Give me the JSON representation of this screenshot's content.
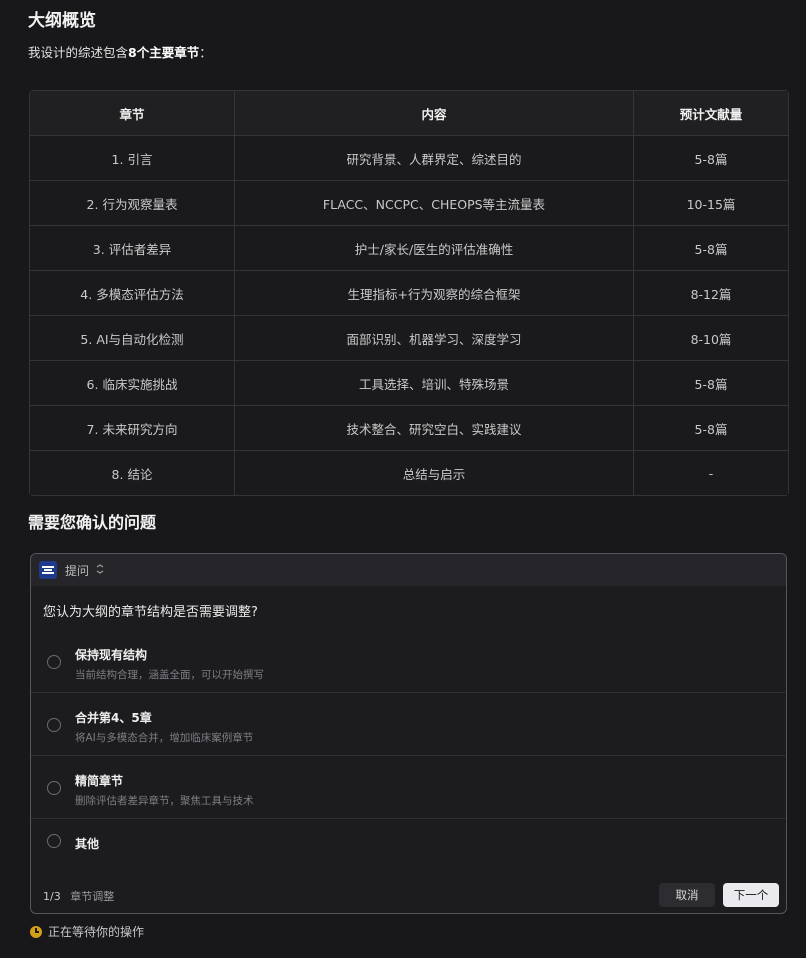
{
  "outline": {
    "heading": "大纲概览",
    "intro_prefix": "我设计的综述包含",
    "intro_bold": "8个主要章节",
    "intro_suffix": "：",
    "columns": [
      "章节",
      "内容",
      "预计文献量"
    ],
    "rows": [
      [
        "1. 引言",
        "研究背景、人群界定、综述目的",
        "5-8篇"
      ],
      [
        "2. 行为观察量表",
        "FLACC、NCCPC、CHEOPS等主流量表",
        "10-15篇"
      ],
      [
        "3. 评估者差异",
        "护士/家长/医生的评估准确性",
        "5-8篇"
      ],
      [
        "4. 多模态评估方法",
        "生理指标+行为观察的综合框架",
        "8-12篇"
      ],
      [
        "5. AI与自动化检测",
        "面部识别、机器学习、深度学习",
        "8-10篇"
      ],
      [
        "6. 临床实施挑战",
        "工具选择、培训、特殊场景",
        "5-8篇"
      ],
      [
        "7. 未来研究方向",
        "技术整合、研究空白、实践建议",
        "5-8篇"
      ],
      [
        "8. 结论",
        "总结与启示",
        "-"
      ]
    ]
  },
  "confirm_heading": "需要您确认的问题",
  "card": {
    "header_label": "提问",
    "header_icon": "expand-collapse-icon",
    "question": "您认为大纲的章节结构是否需要调整?",
    "options": [
      {
        "title": "保持现有结构",
        "subtitle": "当前结构合理，涵盖全面，可以开始撰写"
      },
      {
        "title": "合并第4、5章",
        "subtitle": "将AI与多模态合并，增加临床案例章节"
      },
      {
        "title": "精简章节",
        "subtitle": "删除评估者差异章节，聚焦工具与技术"
      },
      {
        "title": "其他",
        "subtitle": ""
      }
    ],
    "step": "1/3",
    "step_label": "章节调整",
    "cancel_label": "取消",
    "next_label": "下一个"
  },
  "status_text": "正在等待你的操作",
  "colors": {
    "background": "#18181b",
    "accent_status": "#d4a017"
  }
}
